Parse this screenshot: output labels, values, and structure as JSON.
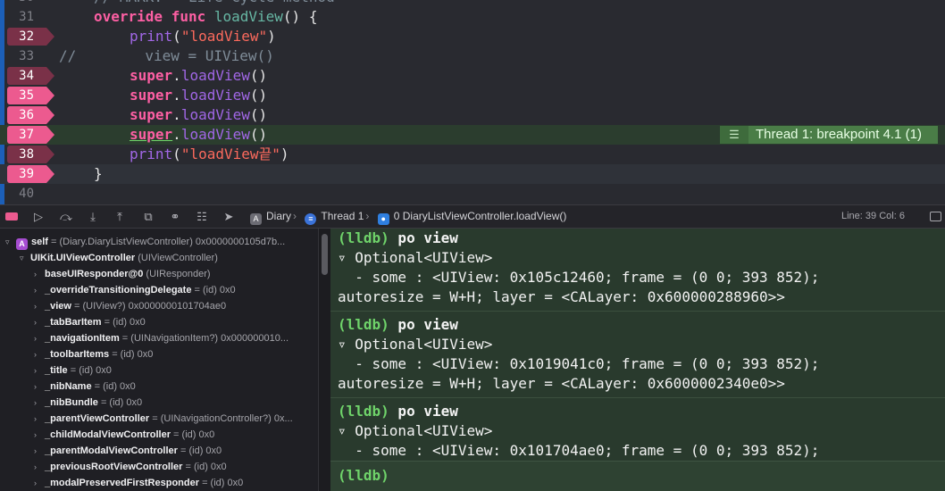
{
  "editor": {
    "partial_comment": "// MARK: - Life Cycle method",
    "lines": [
      {
        "num": "31",
        "text_a": "override func ",
        "text_b": "loadView",
        "text_c": "() {"
      },
      {
        "num": "32",
        "indent": "    ",
        "fn": "print",
        "s": "\"loadView\"",
        "close": ")"
      },
      {
        "num": "33",
        "comment": "//        view = UIView()"
      },
      {
        "num": "34",
        "sup": "super",
        "dot": ".",
        "m": "loadView",
        "close": "()"
      },
      {
        "num": "35",
        "sup": "super",
        "dot": ".",
        "m": "loadView",
        "close": "()"
      },
      {
        "num": "36",
        "sup": "super",
        "dot": ".",
        "m": "loadView",
        "close": "()"
      },
      {
        "num": "37",
        "sup": "super",
        "dot": ".",
        "m": "loadView",
        "close": "()"
      },
      {
        "num": "38",
        "fn": "print",
        "s": "\"loadView끝\"",
        "close": ")"
      },
      {
        "num": "39",
        "text": "}"
      },
      {
        "num": "40",
        "text": ""
      }
    ],
    "thread_badge": "Thread 1: breakpoint 4.1 (1)",
    "accent_breakpoint": "#ec5a8f",
    "accent_thread": "#4a7d47"
  },
  "debugbar": {
    "icons": [
      "breakpoint-toggle-icon",
      "continue-icon",
      "step-over-icon",
      "step-into-icon",
      "step-out-icon",
      "view-hierarchy-icon",
      "memory-graph-icon",
      "environment-icon",
      "location-icon"
    ],
    "breadcrumb": {
      "target": "Diary",
      "thread": "Thread 1",
      "frame": "0 DiaryListViewController.loadView()"
    },
    "status": "Line: 39  Col: 6"
  },
  "variables": [
    {
      "tri": "▿",
      "badge": "A",
      "name": "self",
      "type": " = (Diary.DiaryListViewController) 0x0000000105d7b...",
      "level": 0
    },
    {
      "tri": "▿",
      "name": "UIKit.UIViewController",
      "type": " (UIViewController)",
      "level": 1
    },
    {
      "tri": "›",
      "name": "baseUIResponder@0",
      "type": " (UIResponder)",
      "level": 2
    },
    {
      "tri": "›",
      "name": "_overrideTransitioningDelegate",
      "type": " = (id) 0x0",
      "level": 2
    },
    {
      "tri": "›",
      "name": "_view",
      "type": " = (UIView?) 0x0000000101704ae0",
      "level": 2
    },
    {
      "tri": "›",
      "name": "_tabBarItem",
      "type": " = (id) 0x0",
      "level": 2
    },
    {
      "tri": "›",
      "name": "_navigationItem",
      "type": " = (UINavigationItem?) 0x000000010...",
      "level": 2
    },
    {
      "tri": "›",
      "name": "_toolbarItems",
      "type": " = (id) 0x0",
      "level": 2
    },
    {
      "tri": "›",
      "name": "_title",
      "type": " = (id) 0x0",
      "level": 2
    },
    {
      "tri": "›",
      "name": "_nibName",
      "type": " = (id) 0x0",
      "level": 2
    },
    {
      "tri": "›",
      "name": "_nibBundle",
      "type": " = (id) 0x0",
      "level": 2
    },
    {
      "tri": "›",
      "name": "_parentViewController",
      "type": " = (UINavigationController?) 0x...",
      "level": 2
    },
    {
      "tri": "›",
      "name": "_childModalViewController",
      "type": " = (id) 0x0",
      "level": 2
    },
    {
      "tri": "›",
      "name": "_parentModalViewController",
      "type": " = (id) 0x0",
      "level": 2
    },
    {
      "tri": "›",
      "name": "_previousRootViewController",
      "type": " = (id) 0x0",
      "level": 2
    },
    {
      "tri": "›",
      "name": "_modalPreservedFirstResponder",
      "type": " = (id) 0x0",
      "level": 2
    }
  ],
  "console": {
    "blocks": [
      {
        "prompt": "(lldb)",
        "cmd": " po view",
        "l1": "▿ Optional<UIView>",
        "l2": "  - some : <UIView: 0x105c12460; frame = (0 0; 393 852);",
        "l3": "autoresize = W+H; layer = <CALayer: 0x600000288960>>"
      },
      {
        "prompt": "(lldb)",
        "cmd": " po view",
        "l1": "▿ Optional<UIView>",
        "l2": "  - some : <UIView: 0x1019041c0; frame = (0 0; 393 852);",
        "l3": "autoresize = W+H; layer = <CALayer: 0x6000002340e0>>"
      },
      {
        "prompt": "(lldb)",
        "cmd": " po view",
        "l1": "▿ Optional<UIView>",
        "l2": "  - some : <UIView: 0x101704ae0; frame = (0 0; 393 852);"
      }
    ],
    "input_prompt": "(lldb)"
  }
}
